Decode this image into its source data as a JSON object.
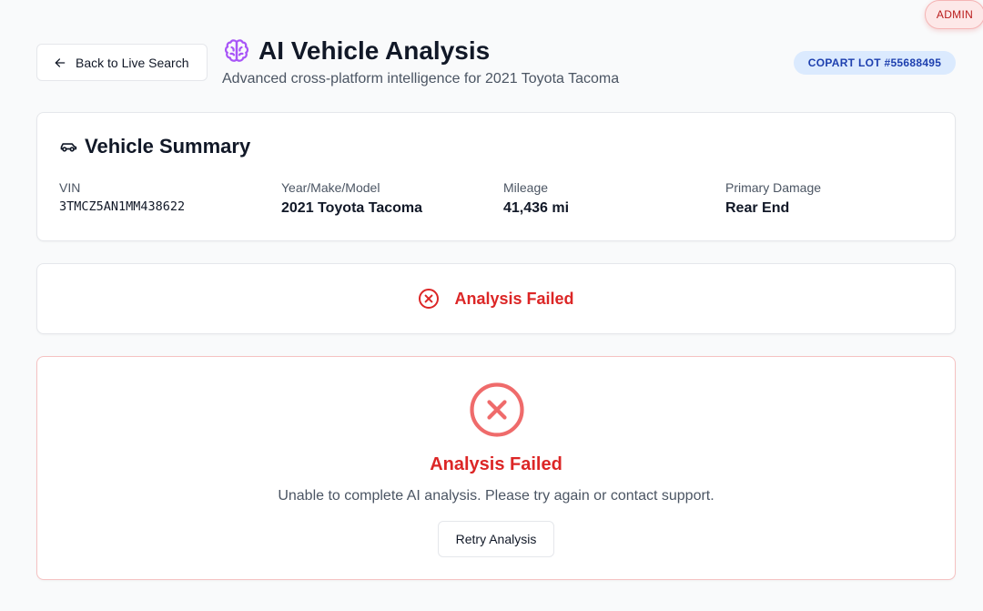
{
  "admin_badge": {
    "label": "ADMIN"
  },
  "header": {
    "back_label": "Back to Live Search",
    "title": "AI Vehicle Analysis",
    "subtitle": "Advanced cross-platform intelligence for 2021 Toyota Tacoma",
    "lot_badge": "COPART LOT #55688495",
    "icons": {
      "back": "arrow-left-icon",
      "title": "brain-icon"
    }
  },
  "summary": {
    "title": "Vehicle Summary",
    "icon": "car-icon",
    "fields": [
      {
        "label": "VIN",
        "value": "3TMCZ5AN1MM438622"
      },
      {
        "label": "Year/Make/Model",
        "value": "2021 Toyota Tacoma"
      },
      {
        "label": "Mileage",
        "value": "41,436 mi"
      },
      {
        "label": "Primary Damage",
        "value": "Rear End"
      }
    ]
  },
  "status": {
    "text": "Analysis Failed",
    "icon": "x-circle-icon"
  },
  "error": {
    "icon": "x-circle-icon",
    "title": "Analysis Failed",
    "message": "Unable to complete AI analysis. Please try again or contact support.",
    "retry_label": "Retry Analysis"
  },
  "colors": {
    "background": "#f9fafb",
    "error": "#dc2626",
    "error_icon_large": "#ef6b6b",
    "brain_icon": "#a855f7",
    "lot_badge_bg": "#dbeafe",
    "lot_badge_text": "#1e40af",
    "admin_badge_bg": "#fde8e8",
    "admin_badge_text": "#b91c1c"
  }
}
